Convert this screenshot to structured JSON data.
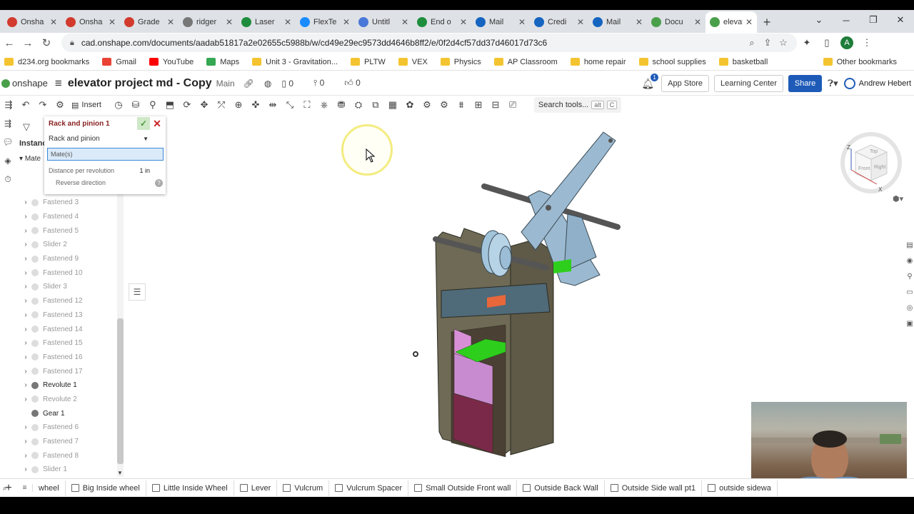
{
  "browser": {
    "tabs": [
      {
        "label": "Onsha",
        "color": "#d23a2e"
      },
      {
        "label": "Onsha",
        "color": "#d23a2e"
      },
      {
        "label": "Grade",
        "color": "#d23a2e"
      },
      {
        "label": "ridger",
        "color": "#777777"
      },
      {
        "label": "Laser",
        "color": "#1e8e3e"
      },
      {
        "label": "FlexTe",
        "color": "#1a8cff"
      },
      {
        "label": "Untitl",
        "color": "#4a78d8"
      },
      {
        "label": "End o",
        "color": "#1e8e3e"
      },
      {
        "label": "Mail",
        "color": "#1565c0"
      },
      {
        "label": "Credi",
        "color": "#1565c0"
      },
      {
        "label": "Mail",
        "color": "#1565c0"
      },
      {
        "label": "Docu",
        "color": "#4aa04a"
      }
    ],
    "active_tab": {
      "label": "elevat",
      "color": "#4aa04a"
    },
    "url": "cad.onshape.com/documents/aadab51817a2e02655c5988b/w/cd49e29ec9573dd4646b8ff2/e/0f2d4cf57dd37d46017d73c6",
    "avatar_letter": "A"
  },
  "bookmarks": [
    {
      "label": "d234.org bookmarks",
      "type": "folder"
    },
    {
      "label": "Gmail",
      "type": "gmail"
    },
    {
      "label": "YouTube",
      "type": "youtube"
    },
    {
      "label": "Maps",
      "type": "maps"
    },
    {
      "label": "Unit 3 - Gravitation...",
      "type": "folder"
    },
    {
      "label": "PLTW",
      "type": "folder"
    },
    {
      "label": "VEX",
      "type": "folder"
    },
    {
      "label": "Physics",
      "type": "folder"
    },
    {
      "label": "AP Classroom",
      "type": "folder"
    },
    {
      "label": "home repair",
      "type": "folder"
    },
    {
      "label": "school supplies",
      "type": "folder"
    },
    {
      "label": "basketball",
      "type": "folder"
    }
  ],
  "bookmarks_other": "Other bookmarks",
  "onshape": {
    "logo": "onshape",
    "doc_title": "elevator project md - Copy",
    "branch": "Main",
    "versions_count": "0",
    "branches_count": "0",
    "likes_count": "0",
    "notification_count": "1",
    "app_store": "App Store",
    "learning_center": "Learning Center",
    "share": "Share",
    "user": "Andrew Hebert"
  },
  "toolbar": {
    "insert": "Insert",
    "search_tools": "Search tools...",
    "search_kbd_1": "alt",
    "search_kbd_2": "C"
  },
  "panel": {
    "instances_label": "Instance",
    "mates_label": "Mate",
    "tree": [
      {
        "label": "Fastened 3",
        "dark": false
      },
      {
        "label": "Fastened 4",
        "dark": false
      },
      {
        "label": "Fastened 5",
        "dark": false
      },
      {
        "label": "Slider 2",
        "dark": false
      },
      {
        "label": "Fastened 9",
        "dark": false
      },
      {
        "label": "Fastened 10",
        "dark": false
      },
      {
        "label": "Slider 3",
        "dark": false
      },
      {
        "label": "Fastened 12",
        "dark": false
      },
      {
        "label": "Fastened 13",
        "dark": false
      },
      {
        "label": "Fastened 14",
        "dark": false
      },
      {
        "label": "Fastened 15",
        "dark": false
      },
      {
        "label": "Fastened 16",
        "dark": false
      },
      {
        "label": "Fastened 17",
        "dark": false
      },
      {
        "label": "Revolute 1",
        "dark": true
      },
      {
        "label": "Revolute 2",
        "dark": false
      },
      {
        "label": "Gear 1",
        "dark": true,
        "nochev": true
      },
      {
        "label": "Fastened 6",
        "dark": false
      },
      {
        "label": "Fastened 7",
        "dark": false
      },
      {
        "label": "Fastened 8",
        "dark": false
      },
      {
        "label": "Slider 1",
        "dark": false
      }
    ]
  },
  "dialog": {
    "title": "Rack and pinion 1",
    "type_value": "Rack and pinion",
    "mates_placeholder": "Mate(s)",
    "distance_label": "Distance per revolution",
    "distance_value": "1 in",
    "reverse_label": "Reverse direction"
  },
  "bottom_tabs": [
    "wheel",
    "Big Inside wheel",
    "Little Inside Wheel",
    "Lever",
    "Vulcrum",
    "Vulcrum Spacer",
    "Small Outside Front wall",
    "Outside Back Wall",
    "Outside Side wall pt1",
    "outside sidewa"
  ],
  "viewcube": {
    "front": "Front",
    "right": "Right",
    "top": "Top",
    "axis_z": "Z",
    "axis_x": "X"
  }
}
